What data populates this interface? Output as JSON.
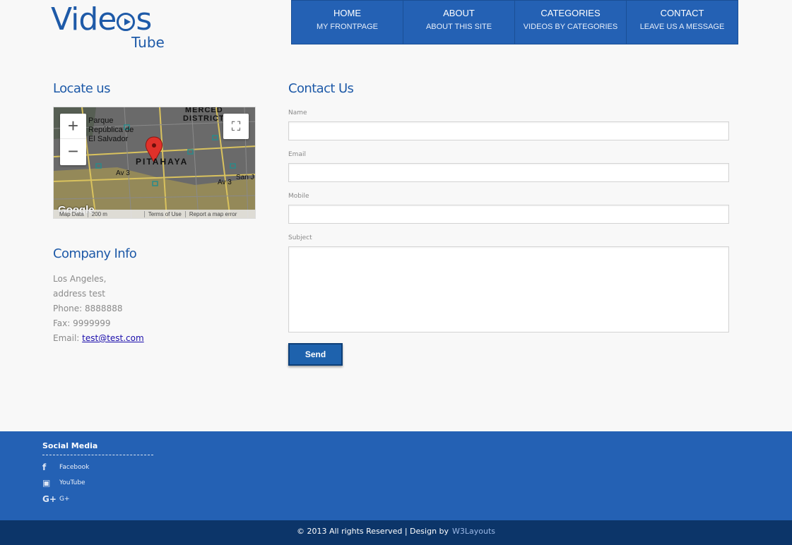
{
  "logo": {
    "main": "Vide",
    "main_after": "s",
    "sub": "Tube"
  },
  "nav": [
    {
      "title": "HOME",
      "sub": "MY FRONTPAGE"
    },
    {
      "title": "ABOUT",
      "sub": "ABOUT THIS SITE"
    },
    {
      "title": "CATEGORIES",
      "sub": "VIDEOS BY CATEGORIES"
    },
    {
      "title": "CONTACT",
      "sub": "LEAVE US A MESSAGE"
    }
  ],
  "locate": {
    "heading": "Locate us"
  },
  "map": {
    "zoom_in": "+",
    "zoom_out": "−",
    "fullscreen": "⛶",
    "labels": [
      "MERCED",
      "DISTRICT",
      "Parque",
      "República de",
      "El Salvador",
      "PITAHAYA",
      "Av 3",
      "Av 3",
      "San J"
    ],
    "google": "Google",
    "footer": [
      "Map Data",
      "200 m",
      "Terms of Use",
      "Report a map error"
    ]
  },
  "company": {
    "heading": "Company Info",
    "lines": [
      "Los Angeles,",
      "address test",
      "Phone: 8888888",
      "Fax: 9999999"
    ],
    "email_label": "Email: ",
    "email": "test@test.com"
  },
  "contact": {
    "heading": "Contact Us",
    "fields": [
      {
        "label": "Name",
        "value": ""
      },
      {
        "label": "Email",
        "value": ""
      },
      {
        "label": "Mobile",
        "value": ""
      },
      {
        "label": "Subject",
        "value": ""
      }
    ],
    "send_label": "Send"
  },
  "footer": {
    "social_title": "Social Media",
    "social": [
      {
        "icon": "facebook-icon",
        "glyph": "f",
        "label": "Facebook"
      },
      {
        "icon": "youtube-icon",
        "glyph": "▣",
        "label": "YouTube"
      },
      {
        "icon": "google-plus-icon",
        "glyph": "G+",
        "label": "G+"
      }
    ],
    "copyright": "© 2013 All rights Reserved | Design by",
    "designer": "W3Layouts"
  },
  "colors": {
    "primary": "#2461b4",
    "dark": "#0c3569",
    "heading": "#1e5aa8"
  }
}
